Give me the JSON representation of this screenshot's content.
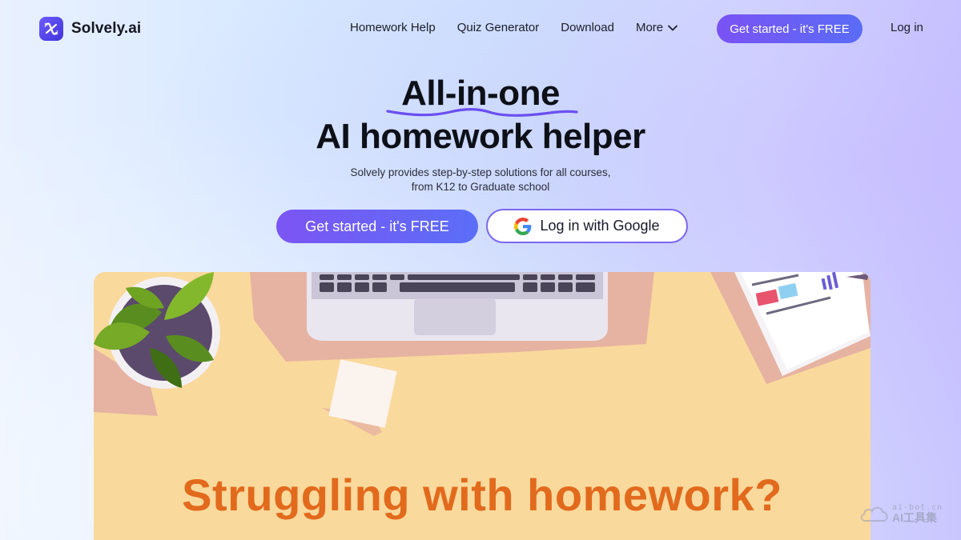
{
  "brand": {
    "name": "Solvely.ai",
    "accent": "#6b5cf6"
  },
  "nav": {
    "items": [
      {
        "label": "Homework Help"
      },
      {
        "label": "Quiz Generator"
      },
      {
        "label": "Download"
      },
      {
        "label": "More",
        "icon": "chevron-down-icon"
      }
    ],
    "cta_label": "Get started - it's FREE",
    "login_label": "Log in"
  },
  "hero": {
    "title_line1": "All-in-one",
    "title_line2": "AI homework helper",
    "subtitle_line1": "Solvely provides step-by-step solutions for all courses,",
    "subtitle_line2": "from K12 to Graduate school",
    "primary_cta": "Get started - it's FREE",
    "google_cta": "Log in with Google"
  },
  "illustration": {
    "headline": "Struggling with homework?",
    "headline_color": "#e26a1d"
  },
  "watermark": {
    "line1": "ai-bot.cn",
    "line2": "AI工具集"
  }
}
